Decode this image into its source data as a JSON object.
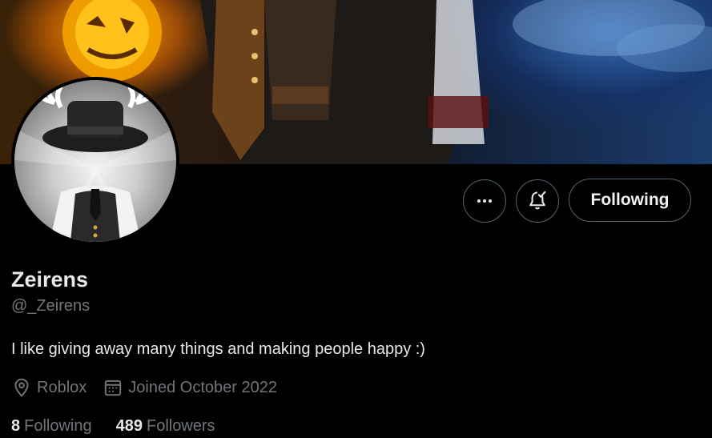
{
  "profile": {
    "display_name": "Zeirens",
    "handle": "@_Zeirens",
    "bio": "I like giving away many things and making people happy :)",
    "location": "Roblox",
    "joined": "Joined October 2022"
  },
  "actions": {
    "more_icon": "more-horizontal-icon",
    "notify_icon": "bell-check-icon",
    "following_label": "Following"
  },
  "stats": {
    "following_count": "8",
    "following_label": "Following",
    "followers_count": "489",
    "followers_label": "Followers"
  },
  "colors": {
    "background": "#000000",
    "primary_text": "#e7e9ea",
    "secondary_text": "#71767b",
    "button_border": "#536471"
  }
}
